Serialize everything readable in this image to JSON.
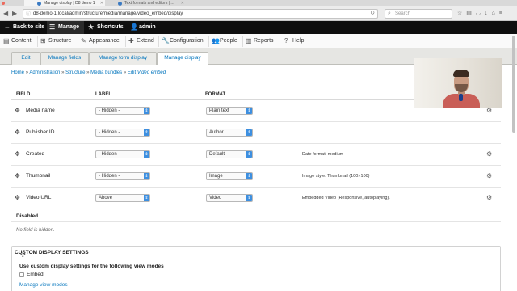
{
  "browser": {
    "tabs": [
      {
        "title": "Manage display | D8 demo 1",
        "active": true
      },
      {
        "title": "Text formats and editors | ...",
        "active": false
      }
    ],
    "url": "d8-demo-1.local/admin/structure/media/manage/video_embed/display",
    "search_placeholder": "Search"
  },
  "toolbar": {
    "back_to_site": "Back to site",
    "manage": "Manage",
    "shortcuts": "Shortcuts",
    "user": "admin"
  },
  "tray": {
    "items": [
      "Content",
      "Structure",
      "Appearance",
      "Extend",
      "Configuration",
      "People",
      "Reports",
      "Help"
    ]
  },
  "subtabs": {
    "items": [
      "Edit",
      "Manage fields",
      "Manage form display",
      "Manage display"
    ],
    "active": "Manage display"
  },
  "breadcrumb": {
    "items": [
      "Home",
      "Administration",
      "Structure",
      "Media bundles"
    ],
    "last_prefix": "Edit",
    "last_emph": "Video embed"
  },
  "table": {
    "headers": {
      "field": "FIELD",
      "label": "LABEL",
      "format": "FORMAT"
    },
    "rows": [
      {
        "name": "Media name",
        "label": "- Hidden -",
        "format": "Plain text",
        "summary": ""
      },
      {
        "name": "Publisher ID",
        "label": "- Hidden -",
        "format": "Author",
        "summary": ""
      },
      {
        "name": "Created",
        "label": "- Hidden -",
        "format": "Default",
        "summary": "Date format: medium"
      },
      {
        "name": "Thumbnail",
        "label": "- Hidden -",
        "format": "Image",
        "summary": "Image style: Thumbnail (100×100)"
      },
      {
        "name": "Video URL",
        "label": "Above",
        "format": "Video",
        "summary": "Embedded Video (Responsive, autoplaying)."
      }
    ],
    "disabled_label": "Disabled",
    "empty_text": "No field is hidden."
  },
  "custom_display": {
    "summary": "CUSTOM DISPLAY SETTINGS",
    "description": "Use custom display settings for the following view modes",
    "option": "Embed",
    "manage_link": "Manage view modes"
  }
}
